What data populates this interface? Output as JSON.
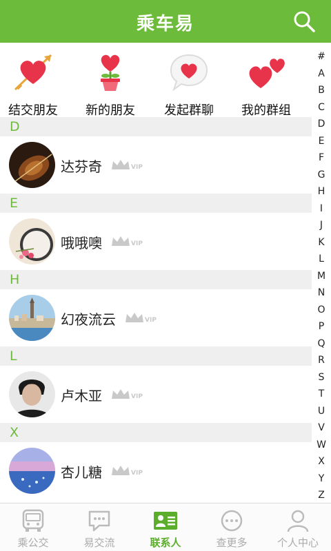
{
  "header": {
    "title": "乘车易",
    "search_icon": "search-icon"
  },
  "quick_actions": [
    {
      "label": "结交朋友",
      "icon": "heart-arrow-icon"
    },
    {
      "label": "新的朋友",
      "icon": "heart-plant-icon"
    },
    {
      "label": "发起群聊",
      "icon": "heart-bubble-icon"
    },
    {
      "label": "我的群组",
      "icon": "two-hearts-icon"
    }
  ],
  "contacts": [
    {
      "section": "D",
      "name": "达芬奇",
      "badge": "VIP"
    },
    {
      "section": "E",
      "name": "哦哦噢",
      "badge": "VIP"
    },
    {
      "section": "H",
      "name": "幻夜流云",
      "badge": "VIP"
    },
    {
      "section": "L",
      "name": "卢木亚",
      "badge": "VIP"
    },
    {
      "section": "X",
      "name": "杏儿糖",
      "badge": "VIP"
    }
  ],
  "index_letters": [
    "#",
    "A",
    "B",
    "C",
    "D",
    "E",
    "F",
    "G",
    "H",
    "I",
    "J",
    "K",
    "L",
    "M",
    "N",
    "O",
    "P",
    "Q",
    "R",
    "S",
    "T",
    "U",
    "V",
    "W",
    "X",
    "Y",
    "Z"
  ],
  "tabs": [
    {
      "label": "乘公交",
      "icon": "bus-icon",
      "active": false
    },
    {
      "label": "易交流",
      "icon": "chat-icon",
      "active": false
    },
    {
      "label": "联系人",
      "icon": "contacts-card-icon",
      "active": true
    },
    {
      "label": "查更多",
      "icon": "more-circle-icon",
      "active": false
    },
    {
      "label": "个人中心",
      "icon": "person-icon",
      "active": false
    }
  ],
  "colors": {
    "brand_green": "#6dbb3a",
    "section_bg": "#efefef",
    "heart_red": "#e8344a"
  }
}
